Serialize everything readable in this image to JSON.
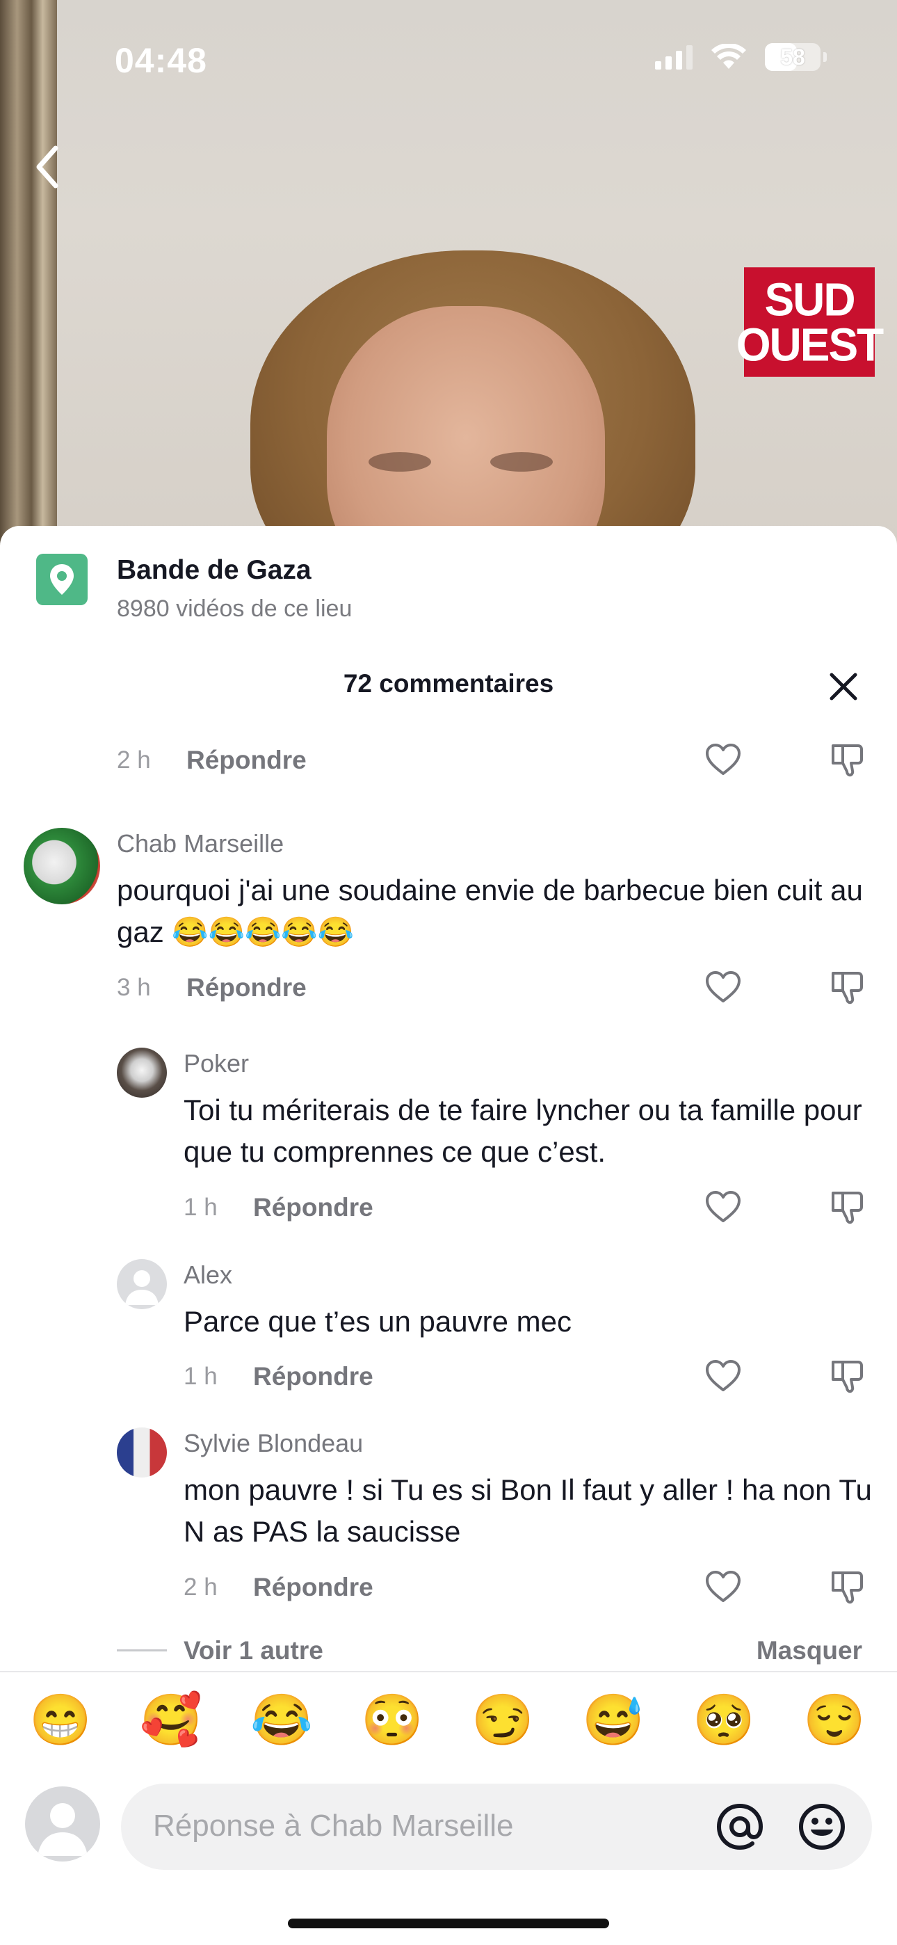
{
  "status_bar": {
    "time": "04:48",
    "battery": "58",
    "battery_level": 0.58
  },
  "video": {
    "logo_line1": "SUD",
    "logo_line2": "OUEST"
  },
  "location": {
    "title": "Bande de Gaza",
    "subtitle": "8980 vidéos de ce lieu"
  },
  "comments_header": {
    "title": "72 commentaires"
  },
  "reply_label": "Répondre",
  "comments": [
    {
      "time": "2 h"
    },
    {
      "name": "Chab Marseille",
      "text": "pourquoi j'ai une soudaine envie de barbecue bien cuit au gaz 😂😂😂😂😂",
      "time": "3 h"
    },
    {
      "name": "Poker",
      "text": "Toi tu mériterais de te faire lyncher ou ta famille pour que tu comprennes ce que c’est.",
      "time": "1 h"
    },
    {
      "name": "Alex",
      "text": "Parce que t’es un pauvre mec",
      "time": "1 h"
    },
    {
      "name": "Sylvie Blondeau",
      "text": "mon pauvre ! si Tu es si Bon Il faut y aller ! ha non Tu N as PAS la saucisse",
      "time": "2 h"
    }
  ],
  "replies_toggle": {
    "more": "Voir 1 autre",
    "hide": "Masquer"
  },
  "emoji_bar": [
    "😁",
    "🥰",
    "😂",
    "😳",
    "😏",
    "😅",
    "🥺",
    "😌"
  ],
  "composer": {
    "placeholder": "Réponse à Chab Marseille"
  }
}
